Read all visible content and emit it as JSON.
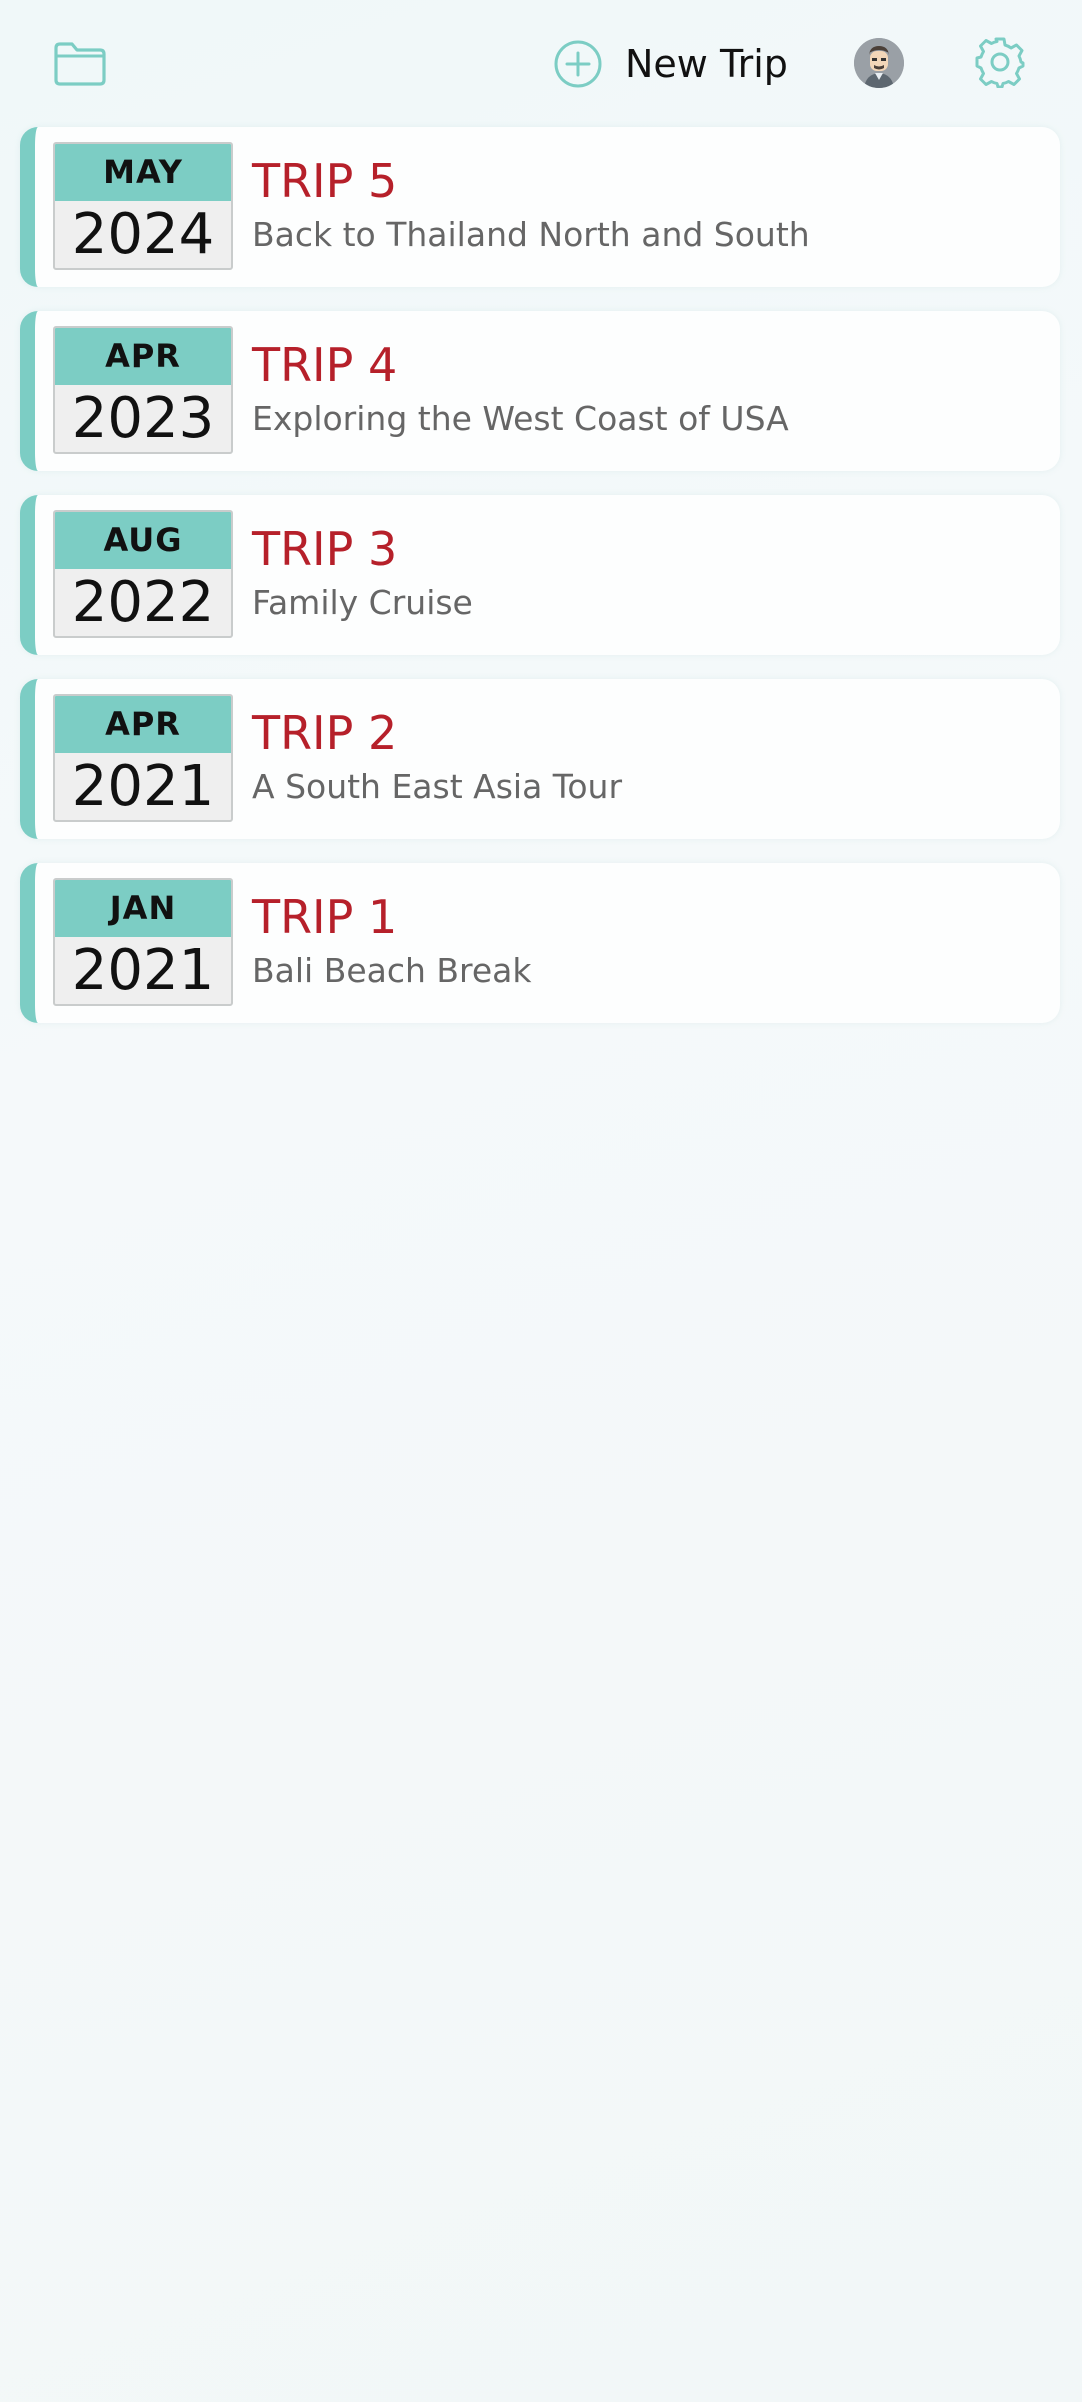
{
  "header": {
    "folder_icon": "folder-icon",
    "new_trip_label": "New Trip",
    "new_trip_icon": "plus-circle-icon",
    "avatar_icon": "user-avatar",
    "settings_icon": "gear-icon",
    "accent_color": "#7ccdc4"
  },
  "trips": [
    {
      "month": "MAY",
      "year": "2024",
      "title": "TRIP 5",
      "subtitle": "Back to Thailand North and South"
    },
    {
      "month": "APR",
      "year": "2023",
      "title": "TRIP 4",
      "subtitle": "Exploring the West Coast of USA"
    },
    {
      "month": "AUG",
      "year": "2022",
      "title": "TRIP 3",
      "subtitle": "Family Cruise"
    },
    {
      "month": "APR",
      "year": "2021",
      "title": "TRIP 2",
      "subtitle": "A South East Asia Tour"
    },
    {
      "month": "JAN",
      "year": "2021",
      "title": "TRIP 1",
      "subtitle": "Bali Beach Break"
    }
  ],
  "colors": {
    "title_red": "#b6202a",
    "subtitle_gray": "#666666",
    "badge_teal": "#7ccdc4"
  }
}
